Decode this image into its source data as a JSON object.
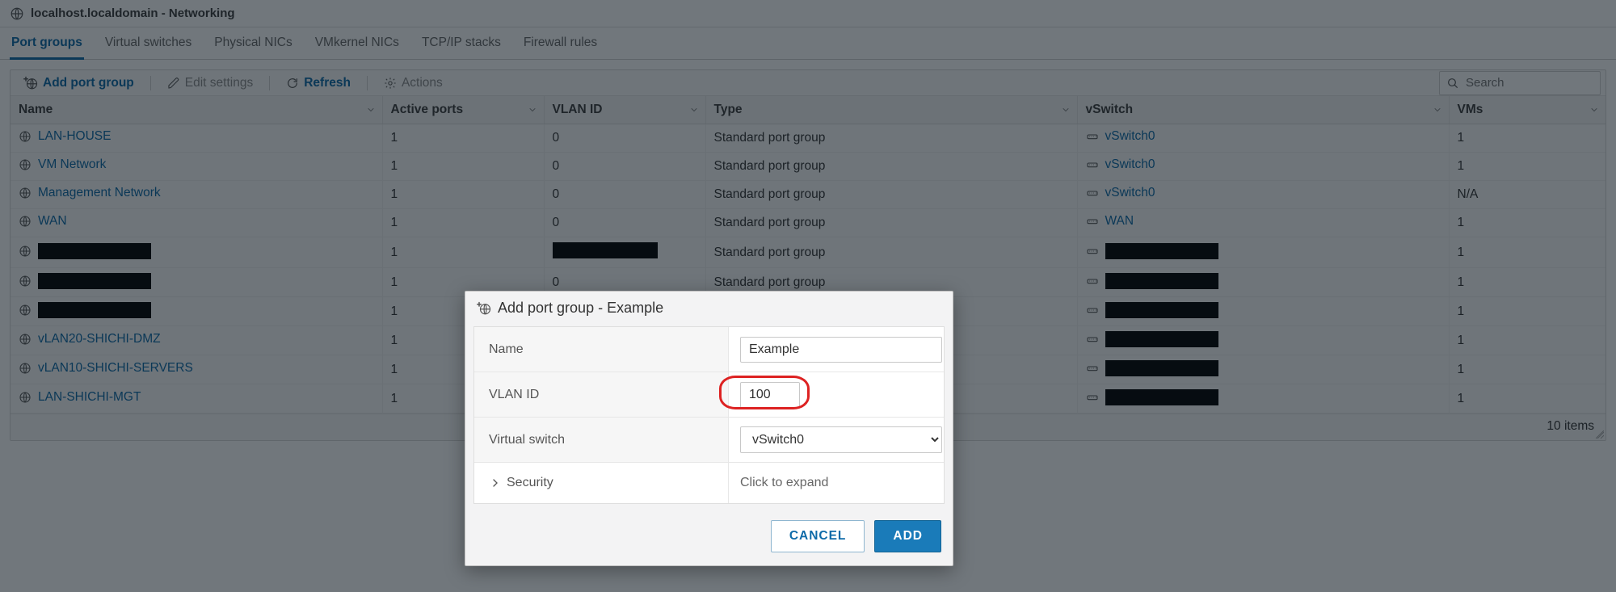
{
  "page": {
    "title": "localhost.localdomain - Networking"
  },
  "tabs": [
    {
      "label": "Port groups",
      "active": true
    },
    {
      "label": "Virtual switches"
    },
    {
      "label": "Physical NICs"
    },
    {
      "label": "VMkernel NICs"
    },
    {
      "label": "TCP/IP stacks"
    },
    {
      "label": "Firewall rules"
    }
  ],
  "toolbar": {
    "add_label": "Add port group",
    "edit_label": "Edit settings",
    "refresh_label": "Refresh",
    "actions_label": "Actions",
    "search_placeholder": "Search"
  },
  "columns": [
    {
      "label": "Name"
    },
    {
      "label": "Active ports"
    },
    {
      "label": "VLAN ID"
    },
    {
      "label": "Type"
    },
    {
      "label": "vSwitch"
    },
    {
      "label": "VMs"
    }
  ],
  "rows": [
    {
      "name": "LAN-HOUSE",
      "name_redacted": false,
      "ports": "1",
      "vlan": "0",
      "vlan_redacted": false,
      "type": "Standard port group",
      "vswitch": "vSwitch0",
      "vswitch_redacted": false,
      "vms": "1"
    },
    {
      "name": "VM Network",
      "name_redacted": false,
      "ports": "1",
      "vlan": "0",
      "vlan_redacted": false,
      "type": "Standard port group",
      "vswitch": "vSwitch0",
      "vswitch_redacted": false,
      "vms": "1"
    },
    {
      "name": "Management Network",
      "name_redacted": false,
      "ports": "1",
      "vlan": "0",
      "vlan_redacted": false,
      "type": "Standard port group",
      "vswitch": "vSwitch0",
      "vswitch_redacted": false,
      "vms": "N/A"
    },
    {
      "name": "WAN",
      "name_redacted": false,
      "ports": "1",
      "vlan": "0",
      "vlan_redacted": false,
      "type": "Standard port group",
      "vswitch": "WAN",
      "vswitch_redacted": false,
      "vms": "1"
    },
    {
      "name": "",
      "name_redacted": true,
      "ports": "1",
      "vlan": "",
      "vlan_redacted": true,
      "type": "Standard port group",
      "vswitch": "",
      "vswitch_redacted": true,
      "vms": "1"
    },
    {
      "name": "",
      "name_redacted": true,
      "ports": "1",
      "vlan": "0",
      "vlan_redacted": false,
      "type": "Standard port group",
      "vswitch": "",
      "vswitch_redacted": true,
      "vms": "1"
    },
    {
      "name": "",
      "name_redacted": true,
      "ports": "1",
      "vlan": "",
      "vlan_redacted": false,
      "type": "",
      "vswitch": "",
      "vswitch_redacted": true,
      "vms": "1"
    },
    {
      "name": "vLAN20-SHICHI-DMZ",
      "name_redacted": false,
      "ports": "1",
      "vlan": "",
      "vlan_redacted": false,
      "type": "",
      "vswitch": "",
      "vswitch_redacted": true,
      "vms": "1"
    },
    {
      "name": "vLAN10-SHICHI-SERVERS",
      "name_redacted": false,
      "ports": "1",
      "vlan": "",
      "vlan_redacted": false,
      "type": "",
      "vswitch": "",
      "vswitch_redacted": true,
      "vms": "1"
    },
    {
      "name": "LAN-SHICHI-MGT",
      "name_redacted": false,
      "ports": "1",
      "vlan": "",
      "vlan_redacted": false,
      "type": "",
      "vswitch": "",
      "vswitch_redacted": true,
      "vms": "1"
    }
  ],
  "footer": {
    "count_label": "10 items"
  },
  "modal": {
    "title": "Add port group - Example",
    "fields": {
      "name_label": "Name",
      "name_value": "Example",
      "vlan_label": "VLAN ID",
      "vlan_value": "100",
      "vswitch_label": "Virtual switch",
      "vswitch_value": "vSwitch0",
      "security_label": "Security",
      "security_hint": "Click to expand"
    },
    "cancel_label": "CANCEL",
    "add_label": "ADD"
  }
}
